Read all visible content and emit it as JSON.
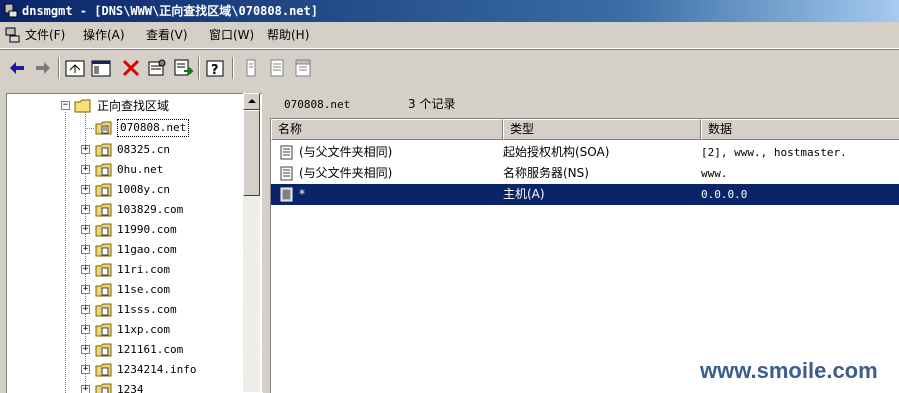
{
  "window": {
    "title": "dnsmgmt - [DNS\\WWW\\正向查找区域\\070808.net]"
  },
  "menu": [
    {
      "label": "文件(F)"
    },
    {
      "label": "操作(A)"
    },
    {
      "label": "查看(V)"
    },
    {
      "label": "窗口(W)"
    },
    {
      "label": "帮助(H)"
    }
  ],
  "toolbar": {
    "buttons": [
      "back-arrow-icon",
      "forward-arrow-icon",
      "up-folder-icon",
      "show-hide-tree-icon",
      "delete-icon",
      "properties-icon",
      "export-list-icon",
      "help-icon",
      "new-record-icon",
      "new-zone-icon",
      "new-domain-icon"
    ]
  },
  "tree": {
    "root_label": "正向查找区域",
    "items": [
      {
        "label": "070808.net"
      },
      {
        "label": "08325.cn"
      },
      {
        "label": "0hu.net"
      },
      {
        "label": "1008y.cn"
      },
      {
        "label": "103829.com"
      },
      {
        "label": "11990.com"
      },
      {
        "label": "11gao.com"
      },
      {
        "label": "11ri.com"
      },
      {
        "label": "11se.com"
      },
      {
        "label": "11sss.com"
      },
      {
        "label": "11xp.com"
      },
      {
        "label": "121161.com"
      },
      {
        "label": "1234214.info"
      },
      {
        "label": "1234"
      }
    ]
  },
  "list": {
    "zone": "070808.net",
    "record_count": "3 个记录",
    "columns": {
      "name": "名称",
      "type": "类型",
      "data": "数据"
    },
    "rows": [
      {
        "name": "(与父文件夹相同)",
        "type": "起始授权机构(SOA)",
        "data": "[2], www., hostmaster."
      },
      {
        "name": "(与父文件夹相同)",
        "type": "名称服务器(NS)",
        "data": "www."
      },
      {
        "name": "*",
        "type": "主机(A)",
        "data": "0.0.0.0"
      }
    ],
    "selected_row": 2
  },
  "watermark": "www.smoile.com",
  "colors": {
    "titlebar": "#0a246a",
    "selection": "#0a246a",
    "chrome": "#d4d0c8"
  }
}
